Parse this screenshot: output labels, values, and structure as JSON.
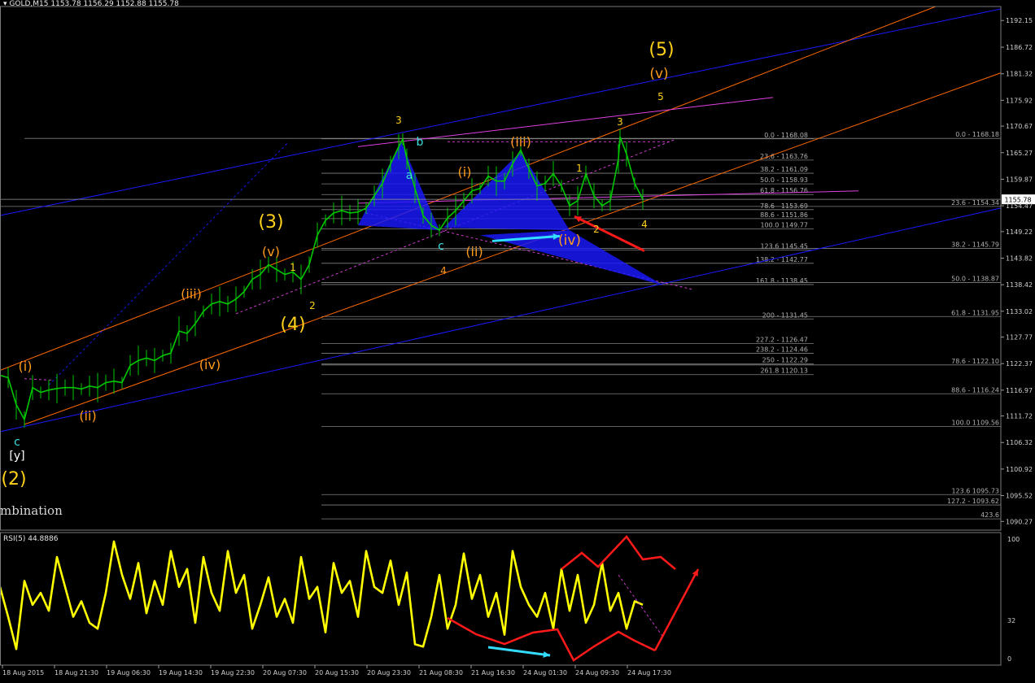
{
  "header": {
    "symbol_label": "GOLD,M15",
    "ohlc": "1153.78 1156.29 1152.88 1155.78"
  },
  "rsi_header": "RSI(5) 44.8886",
  "combination_text": "mbination",
  "colors": {
    "background": "#000000",
    "price_line": "#00c800",
    "rsi": "#ffff00",
    "fib_lines": "#808080",
    "blue_channel": "#1a1aff",
    "orange_channel": "#ff6a00",
    "magenta": "#e040e0",
    "pattern_fill": "#1a1aff",
    "wave_orange": "#ff9a1a",
    "wave_gold": "#ffd11a",
    "wave_cyan": "#39e0e0",
    "arrow_red": "#ff1a1a",
    "arrow_cyan": "#33ddff"
  },
  "chart_data": [
    {
      "type": "line",
      "title": "GOLD,M15",
      "ylim": [
        1088.5,
        1195.0
      ],
      "y_ticks": [
        "1192.15",
        "1186.72",
        "1181.32",
        "1175.92",
        "1170.67",
        "1165.27",
        "1159.87",
        "1154.47",
        "1149.22",
        "1143.82",
        "1138.42",
        "1133.02",
        "1127.77",
        "1122.37",
        "1116.97",
        "1111.72",
        "1106.32",
        "1100.92",
        "1095.52",
        "1090.27"
      ],
      "current_price": "1155.78",
      "x_ticks": [
        "18 Aug 2015",
        "18 Aug 21:30",
        "19 Aug 06:30",
        "19 Aug 14:30",
        "19 Aug 22:30",
        "20 Aug 07:30",
        "20 Aug 15:30",
        "20 Aug 23:30",
        "21 Aug 08:30",
        "21 Aug 16:30",
        "24 Aug 01:30",
        "24 Aug 09:30",
        "24 Aug 17:30"
      ],
      "series": [
        {
          "x": [
            0,
            10,
            20,
            30,
            40,
            50,
            60,
            70,
            80,
            90,
            100,
            110,
            120,
            130,
            140,
            150,
            160,
            170,
            180,
            190,
            200,
            210,
            220,
            230,
            240,
            250,
            260,
            270,
            280,
            290,
            300,
            310,
            320,
            330,
            340,
            350,
            360,
            370,
            380,
            390,
            400,
            410,
            420,
            430,
            440,
            450,
            460,
            470,
            480,
            490,
            495,
            500,
            510,
            520,
            530,
            540,
            550,
            560,
            570,
            580,
            590,
            600,
            610,
            620,
            630,
            640,
            650,
            660,
            670,
            680,
            690,
            700,
            710,
            720,
            730,
            740,
            750,
            760,
            762,
            770,
            780,
            790
          ],
          "values": [
            1120.0,
            1119.5,
            1114.0,
            1111.0,
            1117.5,
            1116.5,
            1117.0,
            1117.3,
            1117.5,
            1117.5,
            1117.2,
            1117.8,
            1117.5,
            1118.5,
            1118.8,
            1118.5,
            1122.0,
            1123.0,
            1123.5,
            1123.0,
            1124.0,
            1124.5,
            1129.0,
            1128.5,
            1130.5,
            1133.0,
            1134.5,
            1135.0,
            1134.5,
            1135.5,
            1137.0,
            1139.5,
            1140.5,
            1142.5,
            1141.5,
            1140.5,
            1141.0,
            1139.5,
            1142.5,
            1148.5,
            1151.5,
            1153.0,
            1153.5,
            1153.0,
            1153.2,
            1154.0,
            1156.5,
            1159.0,
            1163.0,
            1166.5,
            1168.0,
            1164.0,
            1158.0,
            1152.5,
            1150.5,
            1149.5,
            1152.0,
            1153.5,
            1155.5,
            1157.5,
            1158.0,
            1160.5,
            1159.5,
            1159.5,
            1163.0,
            1165.8,
            1162.0,
            1158.5,
            1159.0,
            1161.0,
            1158.5,
            1154.5,
            1155.5,
            1161.0,
            1156.5,
            1154.5,
            1155.5,
            1164.0,
            1168.5,
            1165.0,
            1159.0,
            1155.8
          ]
        }
      ],
      "fib_levels": [
        {
          "label": "0.0 - 1168.08",
          "value": 1168.08
        },
        {
          "label": "23.6 - 1163.76",
          "value": 1163.76
        },
        {
          "label": "38.2 - 1161.09",
          "value": 1161.09
        },
        {
          "label": "50.0 - 1158.93",
          "value": 1158.93
        },
        {
          "label": "61.8 - 1156.76",
          "value": 1156.76
        },
        {
          "label": "78.6 - 1153.69",
          "value": 1153.69
        },
        {
          "label": "88.6 - 1151.86",
          "value": 1151.86
        },
        {
          "label": "100.0 1149.77",
          "value": 1149.77
        },
        {
          "label": "123.6 1145.45",
          "value": 1145.45
        },
        {
          "label": "138.2 - 1142.77",
          "value": 1142.77
        },
        {
          "label": "161.8 - 1138.45",
          "value": 1138.45
        },
        {
          "label": "200 - 1131.45",
          "value": 1131.45
        },
        {
          "label": "227.2 - 1126.47",
          "value": 1126.47
        },
        {
          "label": "238.2 - 1124.46",
          "value": 1124.46
        },
        {
          "label": "250 - 1122.29",
          "value": 1122.29
        },
        {
          "label": "261.8 1120.13",
          "value": 1120.13
        }
      ],
      "fib_levels_right": [
        {
          "label": "0.0 - 1168.18",
          "value": 1168.18
        },
        {
          "label": "23.6 - 1154.34",
          "value": 1154.34
        },
        {
          "label": "38.2 - 1145.79",
          "value": 1145.79
        },
        {
          "label": "50.0 - 1138.87",
          "value": 1138.87
        },
        {
          "label": "61.8 - 1131.95",
          "value": 1131.95
        },
        {
          "label": "78.6 - 1122.10",
          "value": 1122.1
        },
        {
          "label": "88.6 - 1116.24",
          "value": 1116.24
        },
        {
          "label": "100.0 1109.56",
          "value": 1109.56
        },
        {
          "label": "123.6 1095.73",
          "value": 1095.73
        },
        {
          "label": "127.2 - 1093.62",
          "value": 1093.62
        },
        {
          "label": "423.6",
          "value": 1090.8
        }
      ],
      "wave_labels": [
        {
          "text": "(5)",
          "tone": "gold"
        },
        {
          "text": "(v)",
          "tone": "orange"
        },
        {
          "text": "5",
          "tone": "gold"
        },
        {
          "text": "3",
          "tone": "gold"
        },
        {
          "text": "b",
          "tone": "cyan"
        },
        {
          "text": "a",
          "tone": "cyan"
        },
        {
          "text": "3",
          "tone": "gold"
        },
        {
          "text": "(iii)",
          "tone": "orange"
        },
        {
          "text": "(i)",
          "tone": "orange"
        },
        {
          "text": "1",
          "tone": "gold"
        },
        {
          "text": "(3)",
          "tone": "gold"
        },
        {
          "text": "(v)",
          "tone": "orange"
        },
        {
          "text": "1",
          "tone": "gold"
        },
        {
          "text": "(iii)",
          "tone": "orange"
        },
        {
          "text": "2",
          "tone": "gold"
        },
        {
          "text": "(4)",
          "tone": "gold"
        },
        {
          "text": "c",
          "tone": "cyan"
        },
        {
          "text": "(ii)",
          "tone": "orange"
        },
        {
          "text": "4",
          "tone": "orange"
        },
        {
          "text": "(iv)",
          "tone": "orange"
        },
        {
          "text": "2",
          "tone": "gold"
        },
        {
          "text": "4",
          "tone": "gold"
        },
        {
          "text": "(iv)",
          "tone": "orange"
        },
        {
          "text": "(i)",
          "tone": "orange"
        },
        {
          "text": "(ii)",
          "tone": "orange"
        },
        {
          "text": "c",
          "tone": "cyan"
        },
        {
          "text": "[y]",
          "tone": "white"
        },
        {
          "text": "(2)",
          "tone": "gold"
        }
      ]
    },
    {
      "type": "line",
      "title": "RSI(5) 44.8886",
      "ylim": [
        0,
        100
      ],
      "y_ticks": [
        "100",
        "32",
        "0"
      ],
      "series": [
        {
          "x": [
            0,
            10,
            20,
            30,
            40,
            50,
            60,
            70,
            80,
            90,
            100,
            110,
            120,
            130,
            140,
            150,
            160,
            170,
            180,
            190,
            200,
            210,
            220,
            230,
            240,
            250,
            260,
            270,
            280,
            290,
            300,
            310,
            320,
            330,
            340,
            350,
            360,
            370,
            380,
            390,
            400,
            410,
            420,
            430,
            440,
            450,
            460,
            470,
            480,
            490,
            500,
            510,
            520,
            530,
            540,
            550,
            560,
            570,
            580,
            590,
            600,
            610,
            620,
            630,
            640,
            650,
            660,
            670,
            680,
            690,
            700,
            710,
            720,
            730,
            740,
            750,
            760,
            770,
            780,
            790
          ],
          "values": [
            60,
            35,
            8,
            65,
            45,
            55,
            40,
            85,
            60,
            35,
            48,
            30,
            25,
            55,
            98,
            70,
            50,
            80,
            38,
            65,
            45,
            90,
            60,
            75,
            30,
            85,
            55,
            40,
            90,
            55,
            70,
            25,
            45,
            68,
            35,
            50,
            30,
            85,
            50,
            60,
            22,
            80,
            55,
            65,
            35,
            90,
            60,
            55,
            82,
            45,
            72,
            12,
            10,
            35,
            70,
            25,
            45,
            88,
            50,
            70,
            35,
            55,
            20,
            90,
            60,
            45,
            35,
            55,
            25,
            75,
            40,
            70,
            30,
            45,
            80,
            40,
            55,
            25,
            48,
            45
          ]
        }
      ]
    }
  ]
}
